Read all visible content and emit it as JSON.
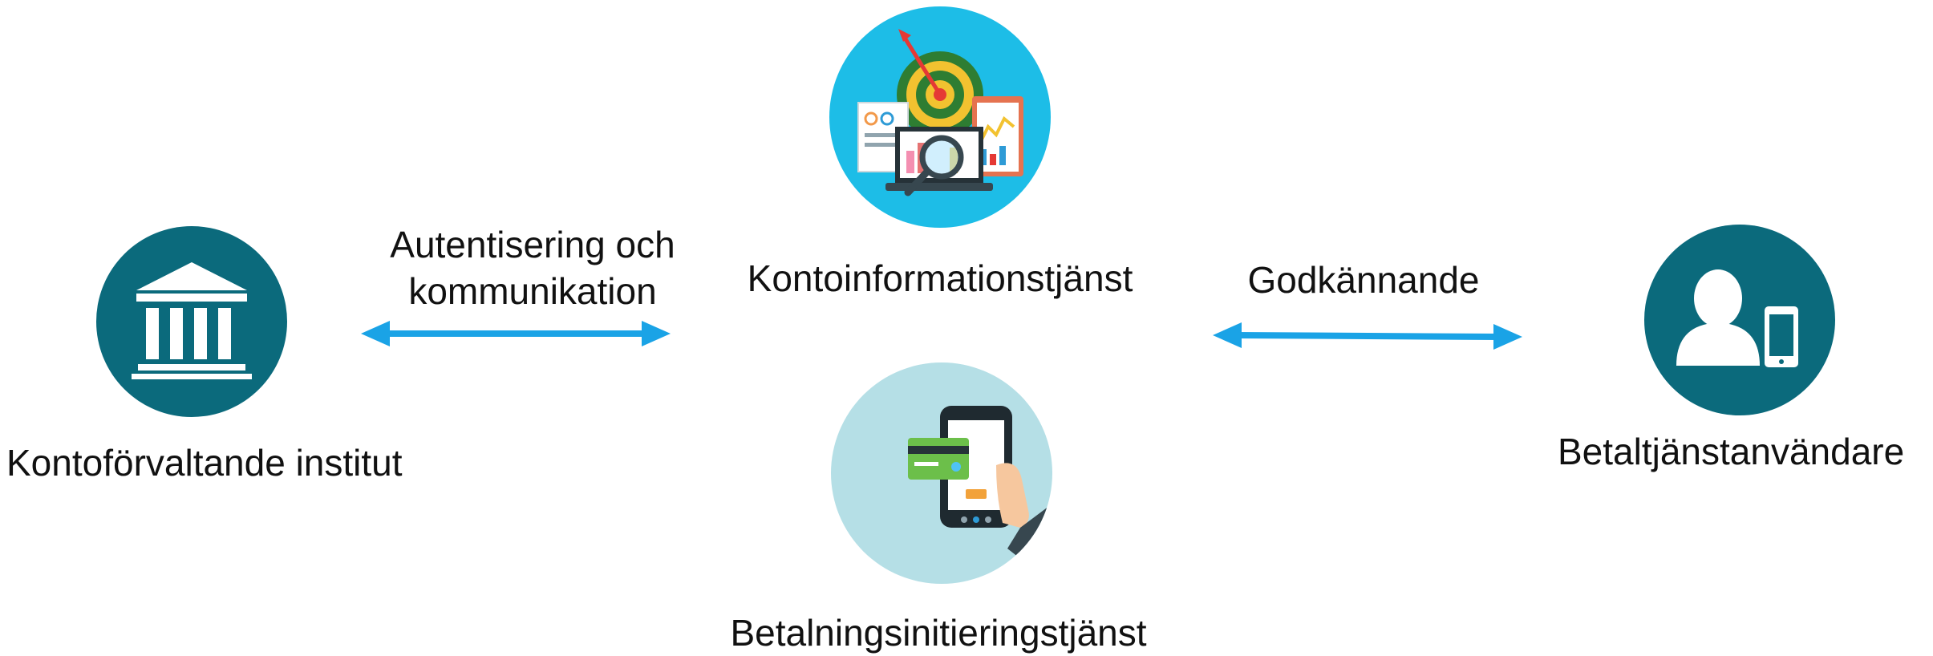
{
  "nodes": {
    "bank": {
      "label": "Kontoförvaltande institut",
      "icon": "bank-icon",
      "color": "#0b6a7c"
    },
    "account_info": {
      "label": "Kontoinformationstjänst",
      "icon": "analytics-dashboard-icon",
      "color": "#1dbde7"
    },
    "payment_init": {
      "label": "Betalningsinitieringstjänst",
      "icon": "mobile-payment-icon",
      "color": "#b5dfe6"
    },
    "user": {
      "label": "Betaltjänstanvändare",
      "icon": "user-with-phone-icon",
      "color": "#0b6a7c"
    }
  },
  "links": {
    "bank_to_services": {
      "line1": "Autentisering och",
      "line2": "kommunikation",
      "color": "#1aa3e6"
    },
    "services_to_user": {
      "label": "Godkännande",
      "color": "#1aa3e6"
    }
  }
}
